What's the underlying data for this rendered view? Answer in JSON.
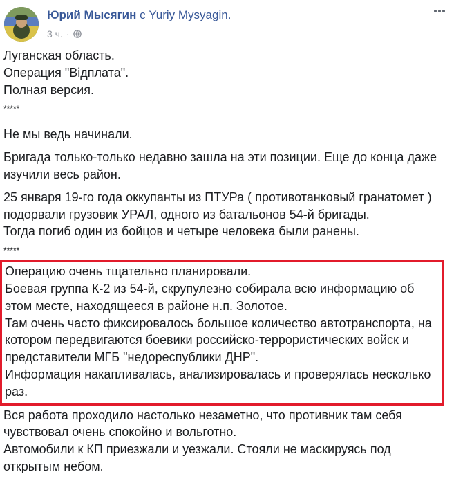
{
  "post": {
    "author": "Юрий Мысягин",
    "with_prefix": "с",
    "with_name": "Yuriy Mysyagin.",
    "time": "3 ч.",
    "privacy_icon": "globe-icon",
    "more_icon": "more-icon"
  },
  "content": {
    "intro": "Луганская область.\nОперация \"Відплата\".\nПолная версия.",
    "divider1": "*****",
    "p1": "Не мы ведь начинали.",
    "p2": "Бригада только-только недавно зашла на эти позиции. Еще до конца даже изучили весь район.",
    "p3": "25 января 19-го года оккупанты из ПТУРа ( противотанковый гранатомет ) подорвали грузовик УРАЛ, одного из батальонов 54-й бригады.\nТогда погиб один из бойцов и четыре человека были ранены.",
    "divider2": "*****",
    "highlight": "Операцию очень тщательно планировали.\nБоевая группа К-2 из 54-й, скрупулезно собирала всю информацию об этом месте, находящееся в районе н.п. Золотое.\nТам очень часто фиксировалось большое количество автотранспорта, на котором передвигаются боевики российско-террористических войск и представители МГБ \"недореспублики ДНР\".\nИнформация накапливалась, анализировалась и проверялась несколько раз.",
    "p4": "Вся работа проходило настолько незаметно, что противник там себя чувствовал очень спокойно и вольготно.\nАвтомобили к КП приезжали и уезжали. Стояли не маскируясь под открытым небом."
  },
  "colors": {
    "link": "#385898",
    "meta": "#90949c",
    "highlight_border": "#e21b2b"
  }
}
